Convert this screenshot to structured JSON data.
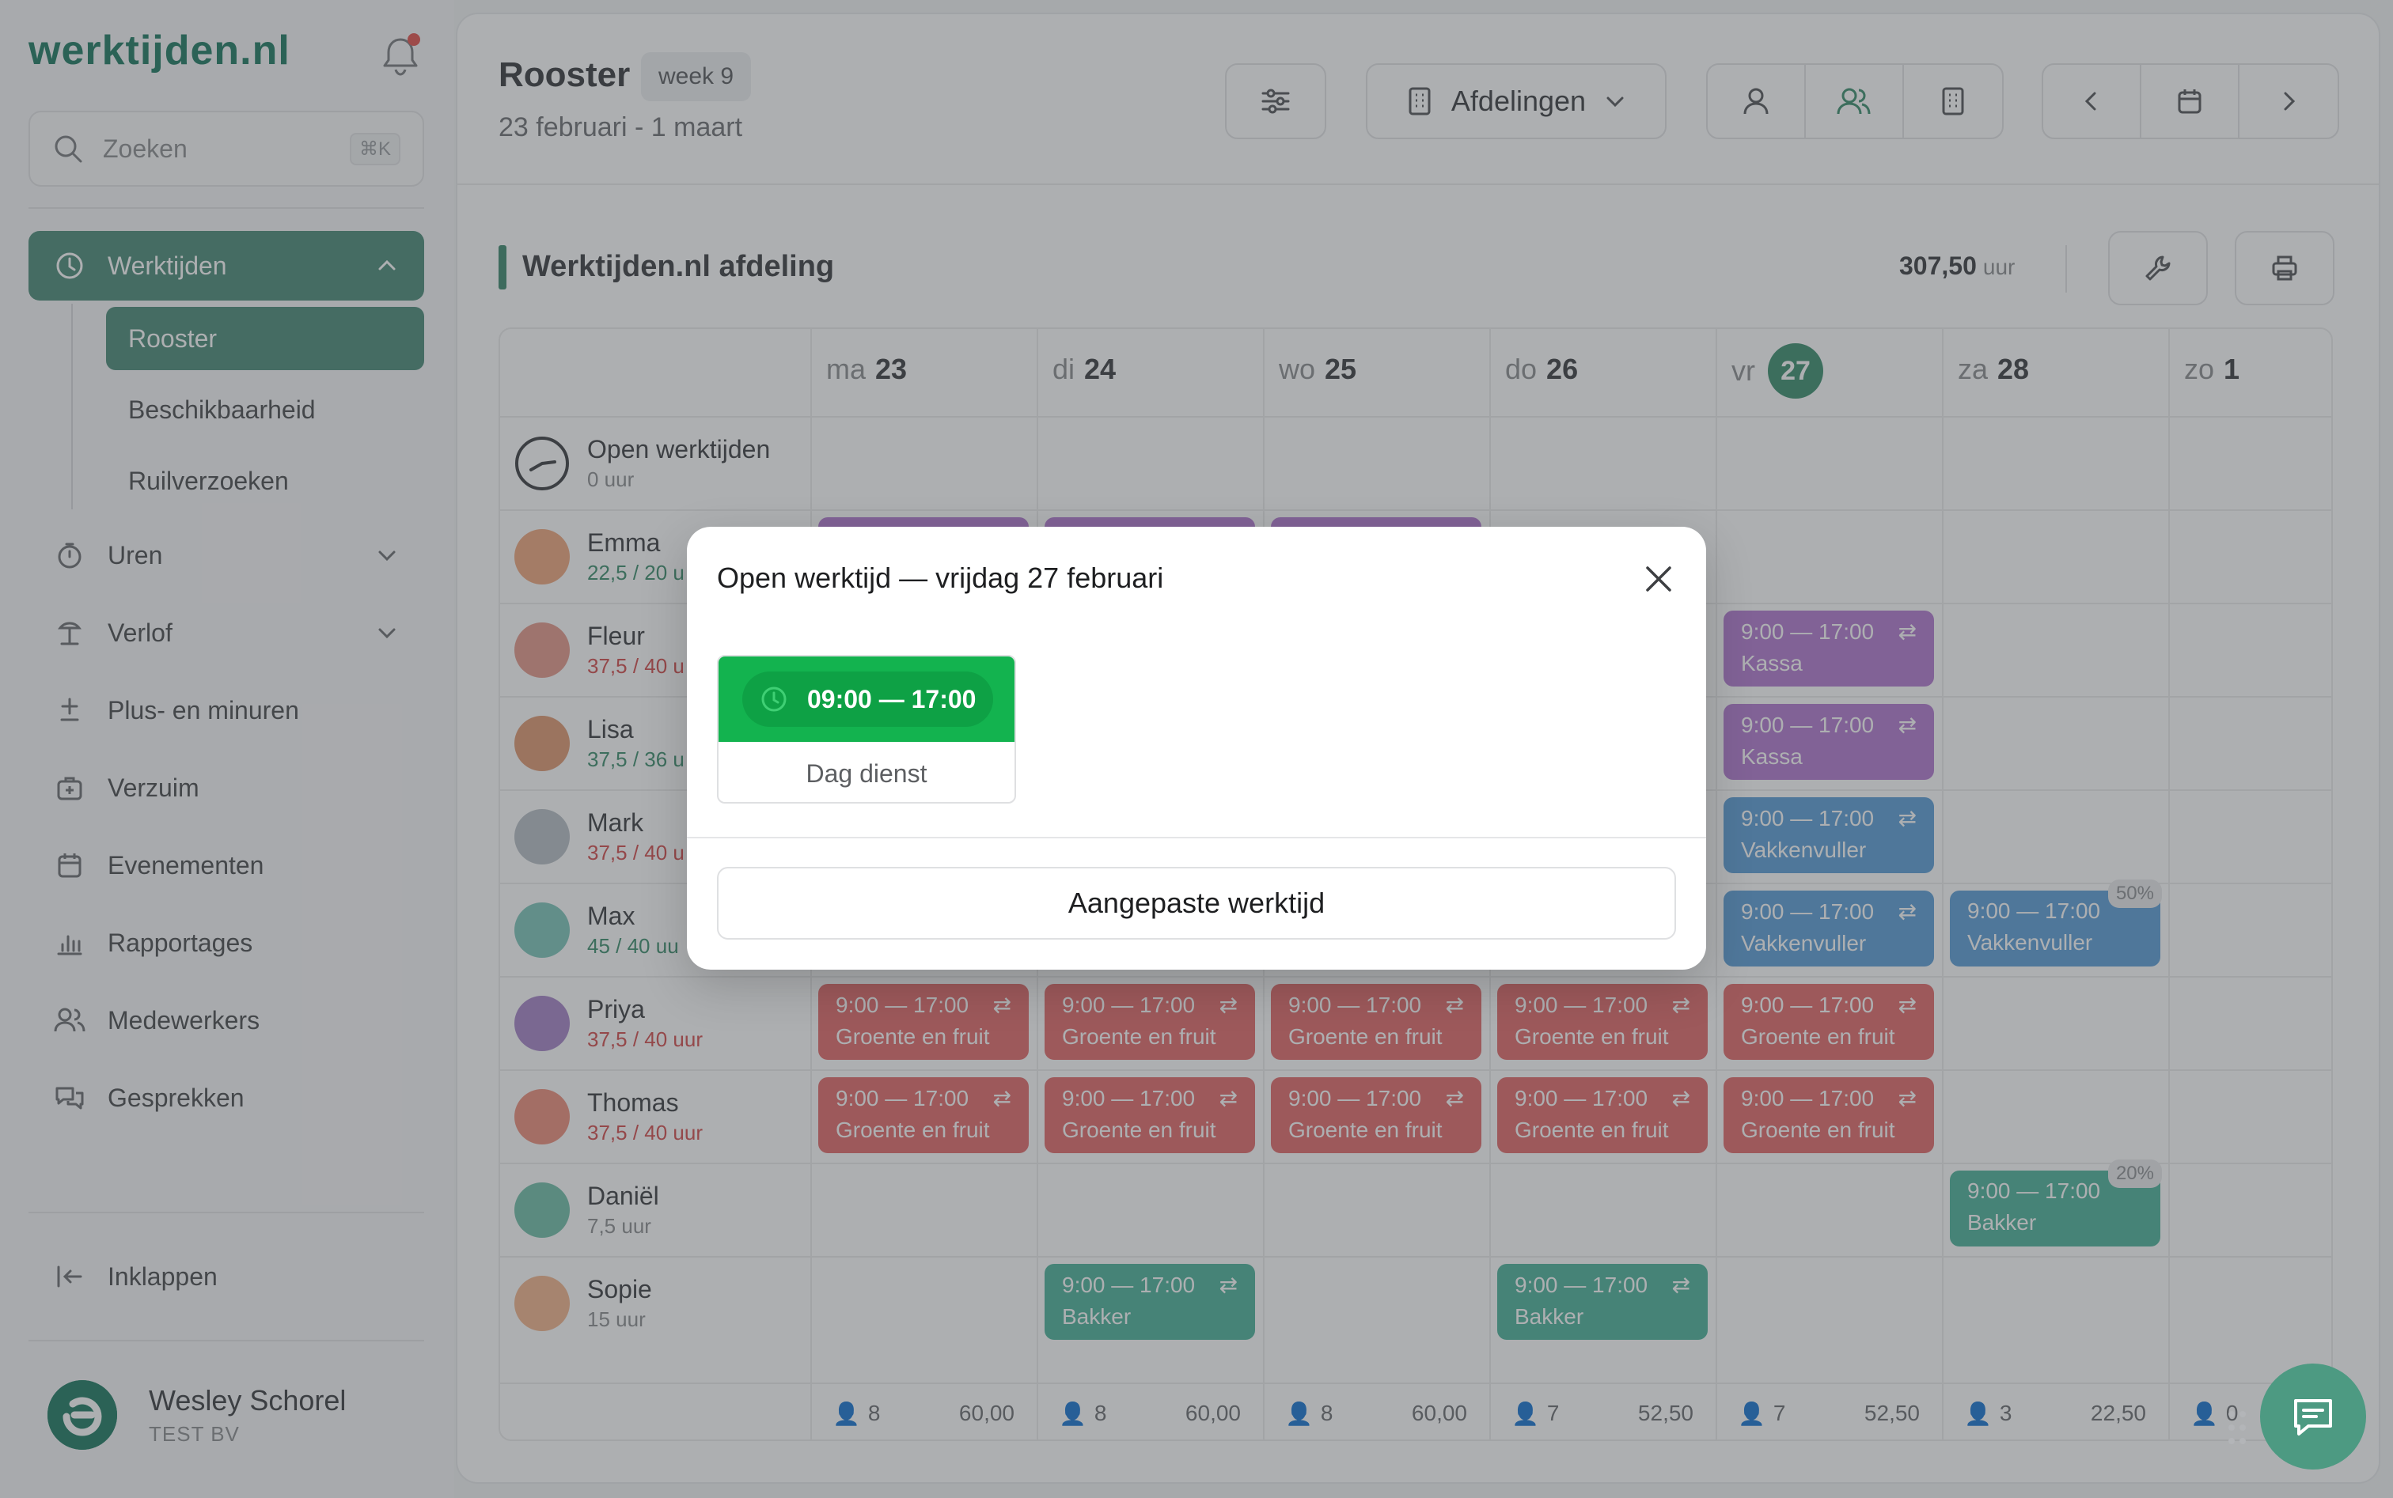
{
  "app": {
    "logo": "werktijden.nl",
    "colors": {
      "brand": "#1f7b62",
      "active_nav": "#4d8c79",
      "today": "#3d8f6f",
      "shift_green": "#13b34f"
    }
  },
  "sidebar": {
    "search_placeholder": "Zoeken",
    "search_shortcut": "⌘K",
    "nav": [
      {
        "label": "Werktijden",
        "icon": "clock-icon",
        "active": true
      },
      {
        "label": "Uren",
        "icon": "stopwatch-icon"
      },
      {
        "label": "Verlof",
        "icon": "beach-icon"
      },
      {
        "label": "Plus- en minuren",
        "icon": "plus-minus-icon"
      },
      {
        "label": "Verzuim",
        "icon": "medical-bag-icon"
      },
      {
        "label": "Evenementen",
        "icon": "calendar-icon"
      },
      {
        "label": "Rapportages",
        "icon": "bar-chart-icon"
      },
      {
        "label": "Medewerkers",
        "icon": "users-icon"
      },
      {
        "label": "Gesprekken",
        "icon": "chat-icon"
      }
    ],
    "sub": [
      "Rooster",
      "Beschikbaarheid",
      "Ruilverzoeken"
    ],
    "collapse_label": "Inklappen",
    "user": {
      "name": "Wesley Schorel",
      "org": "TEST BV"
    }
  },
  "header": {
    "title": "Rooster",
    "week": "week 9",
    "range": "23 februari - 1 maart",
    "departments_label": "Afdelingen"
  },
  "department": {
    "name": "Werktijden.nl afdeling",
    "total": "307,50",
    "total_unit": "uur"
  },
  "days": [
    {
      "dow": "ma",
      "num": "23"
    },
    {
      "dow": "di",
      "num": "24"
    },
    {
      "dow": "wo",
      "num": "25"
    },
    {
      "dow": "do",
      "num": "26"
    },
    {
      "dow": "vr",
      "num": "27",
      "today": true
    },
    {
      "dow": "za",
      "num": "28"
    },
    {
      "dow": "zo",
      "num": "1"
    }
  ],
  "employees": [
    {
      "name": "Open werktijden",
      "hours": "0 uur"
    },
    {
      "name": "Emma",
      "hours": "22,5 / 20 u"
    },
    {
      "name": "Fleur",
      "hours": "37,5 / 40 u"
    },
    {
      "name": "Lisa",
      "hours": "37,5 / 36 u"
    },
    {
      "name": "Mark",
      "hours": "37,5 / 40 u"
    },
    {
      "name": "Max",
      "hours": "45 / 40 uu"
    },
    {
      "name": "Priya",
      "hours": "37,5 / 40 uur"
    },
    {
      "name": "Thomas",
      "hours": "37,5 / 40 uur"
    },
    {
      "name": "Daniël",
      "hours": "7,5 uur"
    },
    {
      "name": "Sopie",
      "hours": "15 uur"
    }
  ],
  "shifts": {
    "time": "9:00 — 17:00",
    "kassa": "Kassa",
    "vakkenvuller": "Vakkenvuller",
    "groente": "Groente en fruit",
    "bakker": "Bakker",
    "pct_max": "50%",
    "pct_daniel": "20%"
  },
  "footer": [
    {
      "count": "8",
      "hours": "60,00"
    },
    {
      "count": "8",
      "hours": "60,00"
    },
    {
      "count": "8",
      "hours": "60,00"
    },
    {
      "count": "7",
      "hours": "52,50"
    },
    {
      "count": "7",
      "hours": "52,50"
    },
    {
      "count": "3",
      "hours": "22,50"
    },
    {
      "count": "0",
      "hours": ""
    }
  ],
  "modal": {
    "title": "Open werktijd — vrijdag 27 februari",
    "shift_time": "09:00 — 17:00",
    "shift_name": "Dag dienst",
    "custom_button": "Aangepaste werktijd"
  }
}
